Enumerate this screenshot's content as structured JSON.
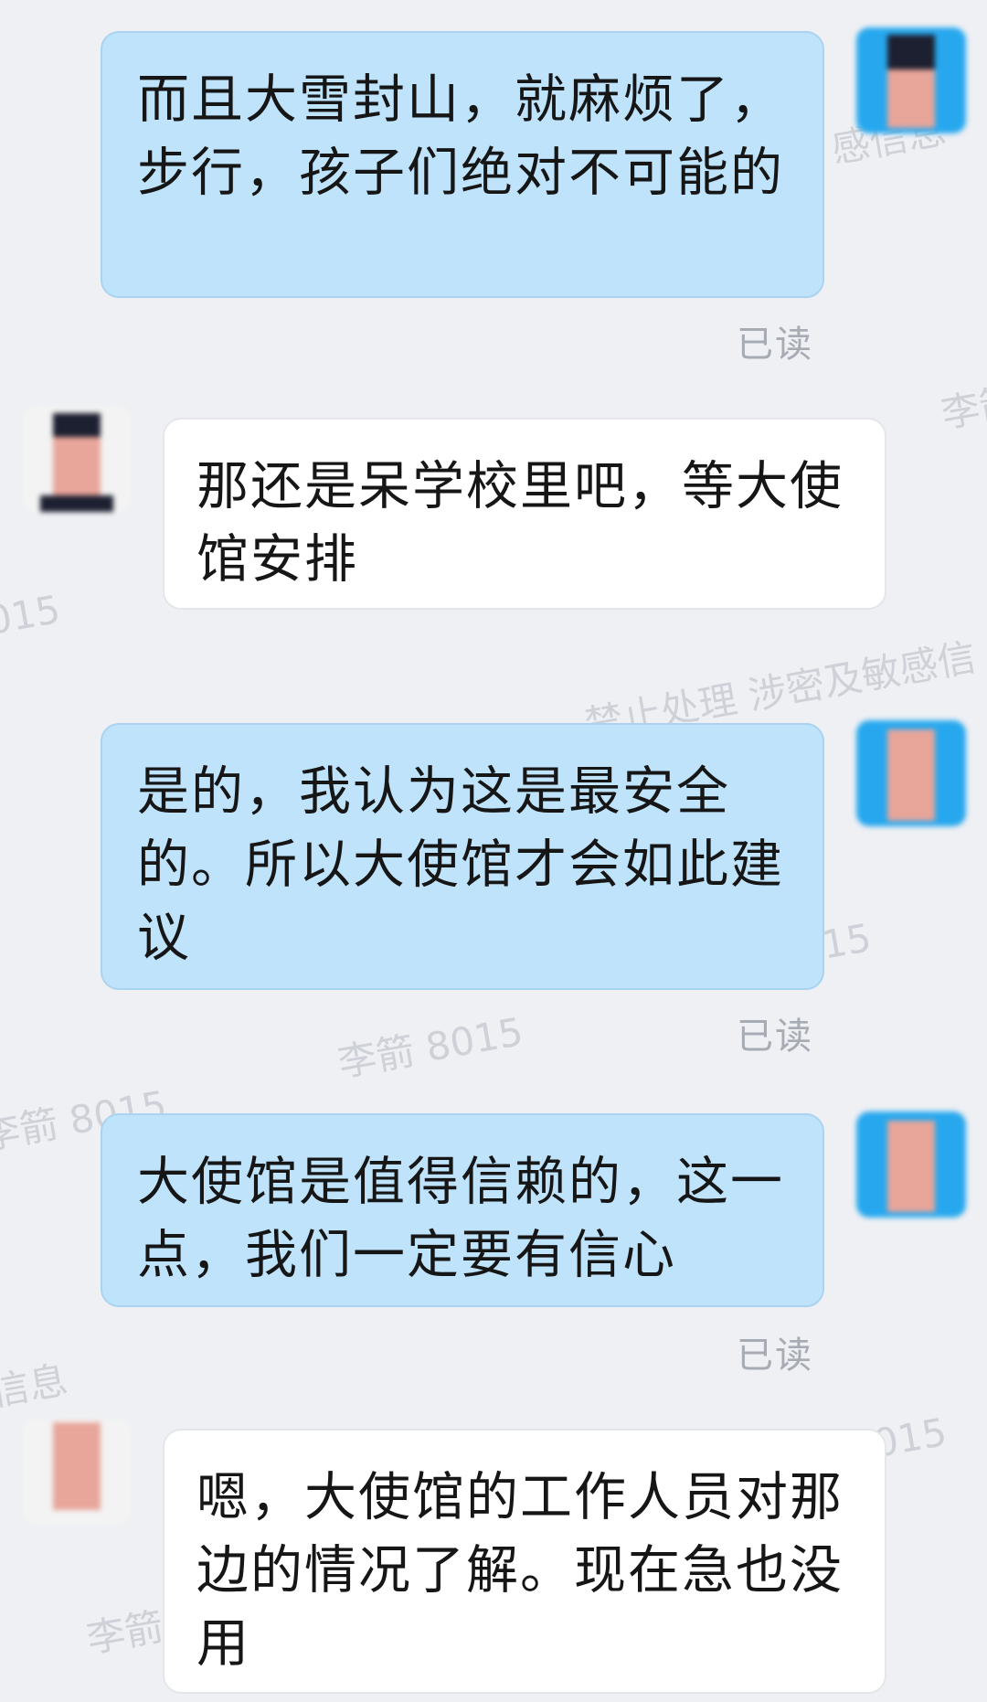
{
  "watermarks": [
    "李箭 8015",
    "涉密及敏感信息",
    "禁止处理 涉密及敏感信",
    "信息"
  ],
  "messages": [
    {
      "side": "sent",
      "text": "而且大雪封山，就麻烦了，步行，孩子们绝对不可能的",
      "status": "已读"
    },
    {
      "side": "received",
      "text": "那还是呆学校里吧，等大使馆安排"
    },
    {
      "side": "sent",
      "text": "是的，我认为这是最安全的。所以大使馆才会如此建议",
      "status": "已读"
    },
    {
      "side": "sent",
      "text": "大使馆是值得信赖的，这一点，我们一定要有信心",
      "status": "已读"
    },
    {
      "side": "received",
      "text": "嗯，大使馆的工作人员对那边的情况了解。现在急也没用"
    }
  ],
  "colors": {
    "background": "#eef0f4",
    "sent_bubble": "#bfe3fb",
    "received_bubble": "#ffffff",
    "read_status": "#a7abb3",
    "sent_avatar": "#27a8ee"
  },
  "icons": {
    "avatar": "avatar-icon"
  }
}
